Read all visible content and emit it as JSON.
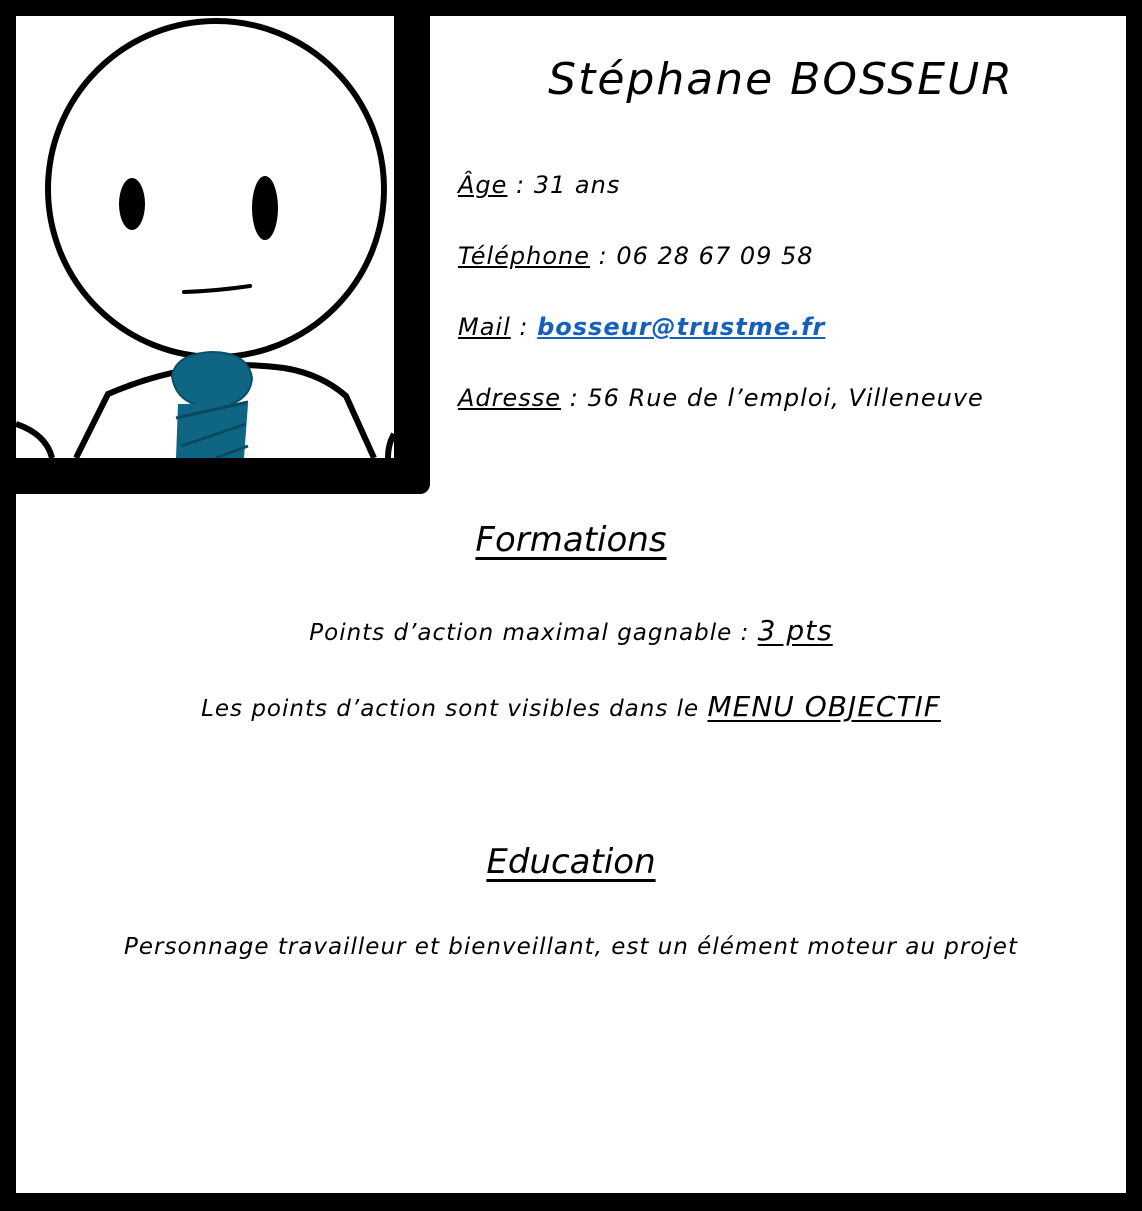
{
  "profile": {
    "name": "Stéphane BOSSEUR",
    "age_label": "Âge",
    "age_value": "31 ans",
    "phone_label": "Téléphone",
    "phone_value": "06 28 67 09 58",
    "mail_label": "Mail",
    "mail_value": "bosseur@trustme.fr",
    "address_label": "Adresse",
    "address_value": "56 Rue de l’emploi, Villeneuve",
    "separator": " : "
  },
  "formations": {
    "title": "Formations",
    "points_text": "Points d’action maximal gagnable : ",
    "points_value": "3 pts",
    "visible_text": "Les points d’action sont visibles dans le ",
    "menu_label": "MENU OBJECTIF"
  },
  "education": {
    "title": "Education",
    "description": "Personnage travailleur et bienveillant, est un élément moteur au projet"
  },
  "colors": {
    "frame": "#000000",
    "background": "#ffffff",
    "tie": "#0e6584",
    "link": "#1560bd"
  }
}
